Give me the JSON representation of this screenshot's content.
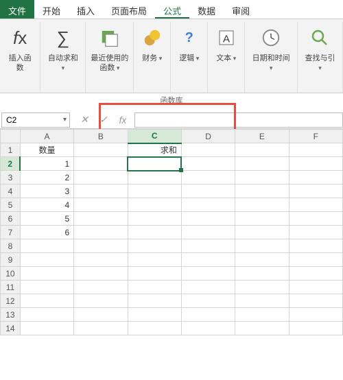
{
  "tabs": {
    "file": "文件",
    "home": "开始",
    "insert": "插入",
    "layout": "页面布局",
    "formulas": "公式",
    "data": "数据",
    "review": "审阅"
  },
  "ribbon": {
    "insert_function": "插入函数",
    "autosum": "自动求和",
    "recently_used": "最近使用的\n函数",
    "financial": "财务",
    "logical": "逻辑",
    "text": "文本",
    "datetime": "日期和时间",
    "lookup": "查找与引",
    "section": "函数库"
  },
  "formula_bar": {
    "namebox": "C2",
    "cancel": "✕",
    "enter": "✓",
    "fx": "fx",
    "value": ""
  },
  "columns": [
    "A",
    "B",
    "C",
    "D",
    "E",
    "F"
  ],
  "rows": [
    "1",
    "2",
    "3",
    "4",
    "5",
    "6",
    "7",
    "8",
    "9",
    "10",
    "11",
    "12",
    "13",
    "14"
  ],
  "cells": {
    "A1": "数量",
    "A2": "1",
    "A3": "2",
    "A4": "3",
    "A5": "4",
    "A6": "5",
    "A7": "6",
    "C1": "求和"
  },
  "selected_cell": "C2",
  "selected_col": "C",
  "selected_row": "2"
}
